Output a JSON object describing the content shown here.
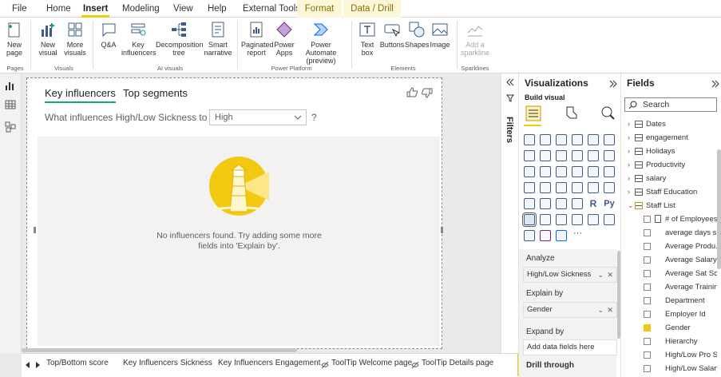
{
  "menu_tabs": [
    {
      "label": "File"
    },
    {
      "label": "Home"
    },
    {
      "label": "Insert"
    },
    {
      "label": "Modeling"
    },
    {
      "label": "View"
    },
    {
      "label": "Help"
    },
    {
      "label": "External Tools"
    },
    {
      "label": "Format"
    },
    {
      "label": "Data / Drill"
    }
  ],
  "ribbon": {
    "new_page": "New page",
    "new_visual": "New visual",
    "more_visuals": "More visuals",
    "qa": "Q&A",
    "key_influencers": "Key influencers",
    "decomposition_tree": "Decomposition tree",
    "smart_narrative": "Smart narrative",
    "paginated_report": "Paginated report",
    "power_apps": "Power Apps",
    "power_automate": "Power Automate (preview)",
    "text_box": "Text box",
    "buttons": "Buttons",
    "shapes": "Shapes",
    "image": "Image",
    "add_sparkline": "Add a sparkline",
    "groups": {
      "pages": "Pages",
      "visuals": "Visuals",
      "ai_visuals": "AI visuals",
      "power_platform": "Power Platform",
      "elements": "Elements",
      "sparklines": "Sparklines"
    }
  },
  "visual": {
    "tab_key_influencers": "Key influencers",
    "tab_top_segments": "Top segments",
    "question": "What influences High/Low Sickness to be",
    "dropdown_value": "High",
    "help": "?",
    "message": "No influencers found. Try adding some more fields into 'Explain by'."
  },
  "page_tabs": [
    "Top/Bottom score",
    "Key Influencers Sickness",
    "Key Influencers Engagement",
    "ToolTip Welcome page",
    "ToolTip Details page"
  ],
  "add_page": "+",
  "filters": {
    "label": "Filters"
  },
  "visualizations": {
    "title": "Visualizations",
    "build_visual": "Build visual",
    "analyze": "Analyze",
    "analyze_field": "High/Low Sickness",
    "explain_by": "Explain by",
    "explain_field": "Gender",
    "expand_by": "Expand by",
    "expand_placeholder": "Add data fields here",
    "drill_through": "Drill through",
    "more": "···"
  },
  "fields": {
    "title": "Fields",
    "search_placeholder": "Search",
    "tables": [
      "Dates",
      "engagement",
      "Holidays",
      "Productivity",
      "salary",
      "Staff Education"
    ],
    "expanded_table": "Staff List",
    "staff_fields": [
      {
        "label": "# of Employees",
        "checked": false
      },
      {
        "label": "average days si...",
        "checked": false
      },
      {
        "label": "Average Produ...",
        "checked": false
      },
      {
        "label": "Average Salary",
        "checked": false
      },
      {
        "label": "Average Sat Sc...",
        "checked": false
      },
      {
        "label": "Average Trainin...",
        "checked": false
      },
      {
        "label": "Department",
        "checked": false
      },
      {
        "label": "Employer Id",
        "checked": false
      },
      {
        "label": "Gender",
        "checked": true
      },
      {
        "label": "Hierarchy",
        "checked": false
      },
      {
        "label": "High/Low Pro S...",
        "checked": false
      },
      {
        "label": "High/Low Salary",
        "checked": false
      }
    ]
  },
  "colors": {
    "accent": "#f2c811",
    "teal": "#1a9e7f",
    "navy": "#3f5a86"
  }
}
